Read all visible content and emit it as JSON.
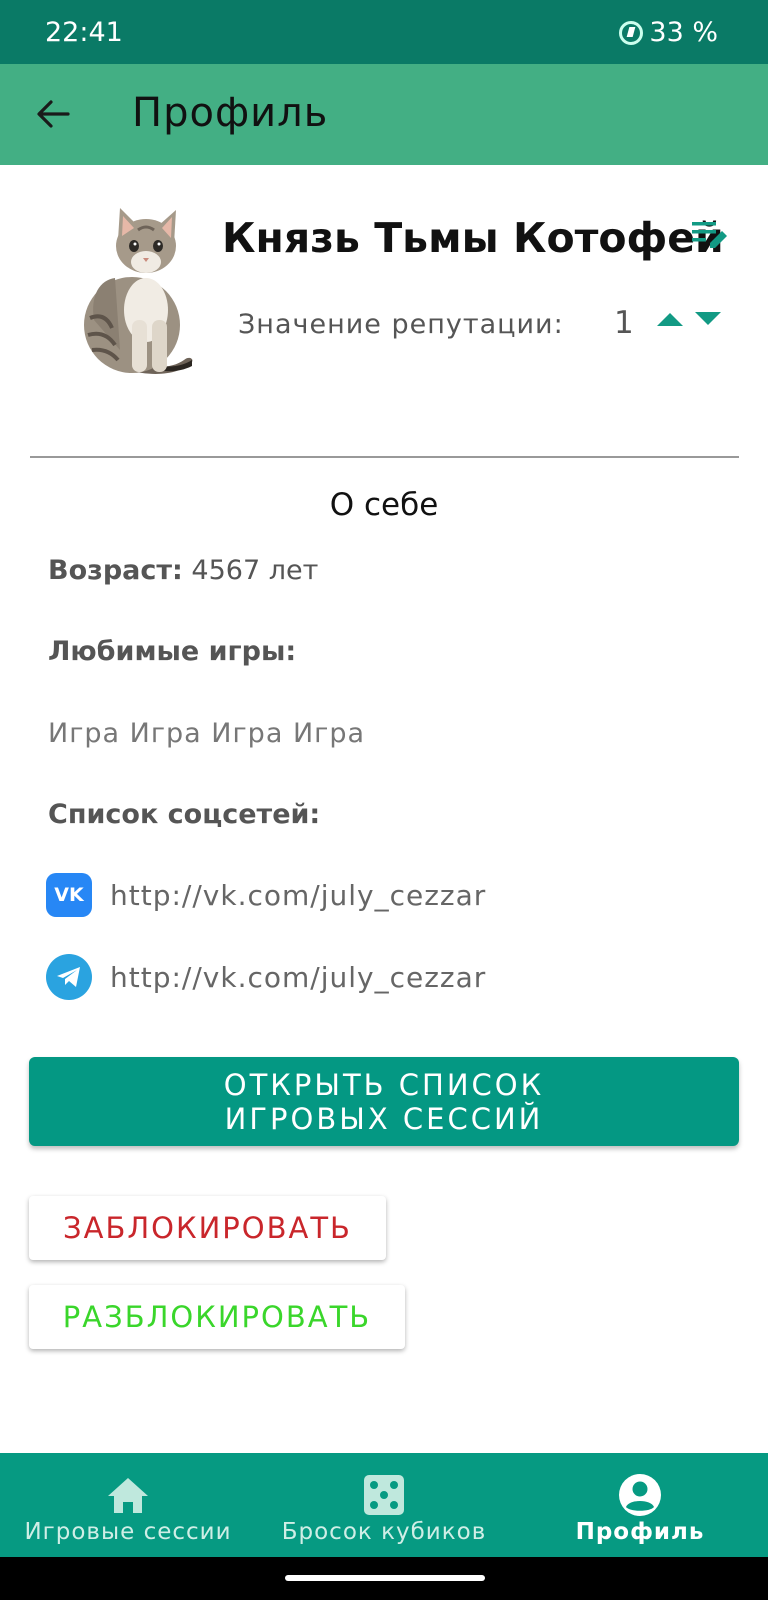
{
  "status_bar": {
    "time": "22:41",
    "battery": "33 %"
  },
  "app_bar": {
    "title": "Профиль",
    "back_icon": "arrow-left-icon"
  },
  "profile": {
    "name": "Князь Тьмы Котофей",
    "reputation_label": "Значение репутации:",
    "reputation_value": "1",
    "avatar_icon": "kitten-photo",
    "edit_icon": "edit-notes-icon"
  },
  "about": {
    "title": "О себе",
    "age_label": "Возраст:",
    "age_value": "4567 лет",
    "games_label": "Любимые игры:",
    "games_value": "Игра Игра Игра Игра",
    "social_label": "Список соцсетей:",
    "socials": [
      {
        "icon": "vk-icon",
        "badge": "VK",
        "url": "http://vk.com/july_cezzar"
      },
      {
        "icon": "telegram-icon",
        "url": "http://vk.com/july_cezzar"
      }
    ]
  },
  "actions": {
    "open_sessions": "ОТКРЫТЬ СПИСОК ИГРОВЫХ СЕССИЙ",
    "block": "ЗАБЛОКИРОВАТЬ",
    "unblock": "РАЗБЛОКИРОВАТЬ"
  },
  "bottom_nav": {
    "items": [
      {
        "label": "Игровые сессии",
        "icon": "home-icon",
        "active": false
      },
      {
        "label": "Бросок кубиков",
        "icon": "dice-icon",
        "active": false
      },
      {
        "label": "Профиль",
        "icon": "account-circle-icon",
        "active": true
      }
    ]
  },
  "colors": {
    "status_bar": "#0a7a66",
    "app_bar": "#43af84",
    "accent": "#049883",
    "block": "#c9262b",
    "unblock": "#3ad62b"
  }
}
